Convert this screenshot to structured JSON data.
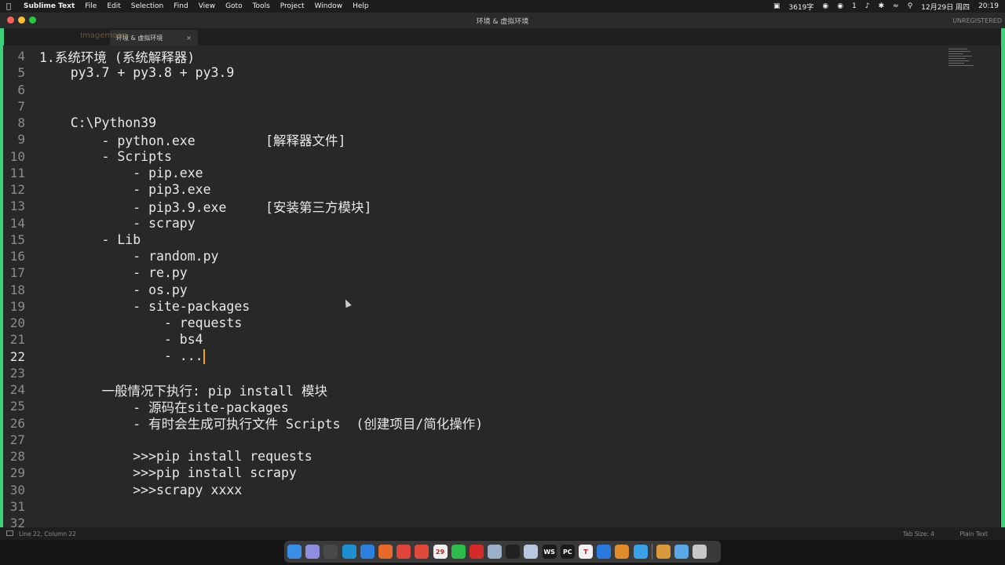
{
  "menubar": {
    "app": "Sublime Text",
    "items": [
      "File",
      "Edit",
      "Selection",
      "Find",
      "View",
      "Goto",
      "Tools",
      "Project",
      "Window",
      "Help"
    ],
    "status": [
      "3619字",
      "1",
      "12月29日 周四",
      "20:19"
    ]
  },
  "window": {
    "title": "环境 & 虚拟环境",
    "unregistered": "UNREGISTERED"
  },
  "tabs": [
    {
      "label": "环境 & 虚拟环境",
      "close": "×"
    }
  ],
  "watermark": "Imagemoon",
  "editor": {
    "current_line": 22,
    "lines": [
      {
        "n": "4",
        "text": "1.系统环境 (系统解释器)"
      },
      {
        "n": "5",
        "text": "    py3.7 + py3.8 + py3.9"
      },
      {
        "n": "6",
        "text": ""
      },
      {
        "n": "7",
        "text": ""
      },
      {
        "n": "8",
        "text": "    C:\\Python39"
      },
      {
        "n": "9",
        "text": "        - python.exe         [解释器文件]"
      },
      {
        "n": "10",
        "text": "        - Scripts"
      },
      {
        "n": "11",
        "text": "            - pip.exe"
      },
      {
        "n": "12",
        "text": "            - pip3.exe"
      },
      {
        "n": "13",
        "text": "            - pip3.9.exe     [安装第三方模块]"
      },
      {
        "n": "14",
        "text": "            - scrapy"
      },
      {
        "n": "15",
        "text": "        - Lib"
      },
      {
        "n": "16",
        "text": "            - random.py"
      },
      {
        "n": "17",
        "text": "            - re.py"
      },
      {
        "n": "18",
        "text": "            - os.py"
      },
      {
        "n": "19",
        "text": "            - site-packages"
      },
      {
        "n": "20",
        "text": "                - requests"
      },
      {
        "n": "21",
        "text": "                - bs4"
      },
      {
        "n": "22",
        "text": "                - ..."
      },
      {
        "n": "23",
        "text": ""
      },
      {
        "n": "24",
        "text": "        一般情况下执行: pip install 模块"
      },
      {
        "n": "25",
        "text": "            - 源码在site-packages"
      },
      {
        "n": "26",
        "text": "            - 有时会生成可执行文件 Scripts  (创建项目/简化操作)"
      },
      {
        "n": "27",
        "text": ""
      },
      {
        "n": "28",
        "text": "            >>>pip install requests"
      },
      {
        "n": "29",
        "text": "            >>>pip install scrapy"
      },
      {
        "n": "30",
        "text": "            >>>scrapy xxxx"
      },
      {
        "n": "31",
        "text": ""
      },
      {
        "n": "32",
        "text": ""
      }
    ]
  },
  "statusbar": {
    "position": "Line 22, Column 22",
    "tab_size": "Tab Size: 4",
    "syntax": "Plain Text"
  },
  "dock": [
    {
      "name": "finder-icon",
      "color": "#3a8ee6"
    },
    {
      "name": "launchpad-icon",
      "color": "#8e8ee0"
    },
    {
      "name": "mission-control-icon",
      "color": "#4a4a4a"
    },
    {
      "name": "chrome-canary-icon",
      "color": "#1e8fcf"
    },
    {
      "name": "safari-icon",
      "color": "#2d7fe0"
    },
    {
      "name": "firefox-icon",
      "color": "#e86a2a"
    },
    {
      "name": "app-red-icon",
      "color": "#e0443a"
    },
    {
      "name": "chrome-icon",
      "color": "#e04a3a"
    },
    {
      "name": "calendar-icon",
      "color": "#f0f0f0",
      "text": "29"
    },
    {
      "name": "wechat-icon",
      "color": "#2dbb4a"
    },
    {
      "name": "netease-music-icon",
      "color": "#d42a2a"
    },
    {
      "name": "preview-icon",
      "color": "#9ab0c8"
    },
    {
      "name": "terminal-icon",
      "color": "#222222"
    },
    {
      "name": "doc-icon",
      "color": "#b8c8e0"
    },
    {
      "name": "webstorm-icon",
      "color": "#1a1a1a",
      "text": "WS"
    },
    {
      "name": "pycharm-icon",
      "color": "#1a1a1a",
      "text": "PC"
    },
    {
      "name": "typora-icon",
      "color": "#f0f0f0",
      "text": "T"
    },
    {
      "name": "xcode-icon",
      "color": "#2a7ae0"
    },
    {
      "name": "sublime-icon",
      "color": "#e08a2a"
    },
    {
      "name": "app-blue-icon",
      "color": "#3aa0e8"
    },
    {
      "name": "archive-icon",
      "color": "#d89a3a"
    },
    {
      "name": "folder-icon",
      "color": "#5aa8e8"
    },
    {
      "name": "trash-icon",
      "color": "#c8c8c8"
    }
  ]
}
